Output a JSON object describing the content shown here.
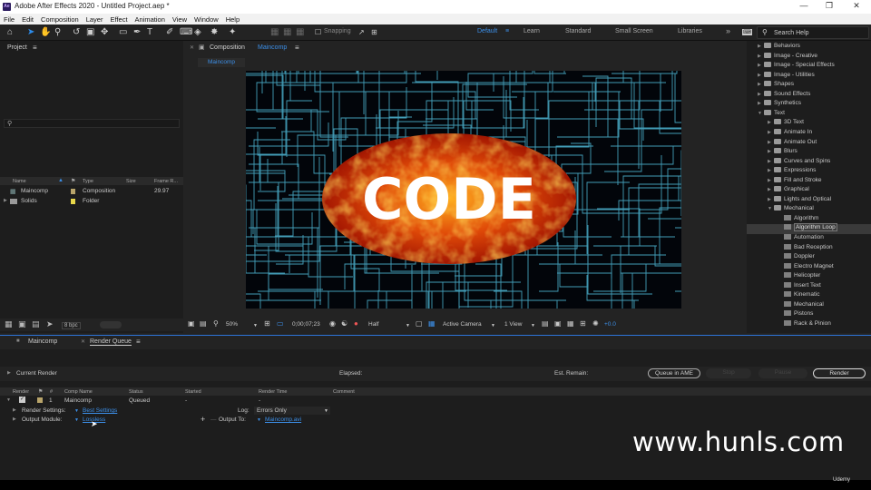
{
  "app": {
    "window_title": "Adobe After Effects 2020 - Untitled Project.aep *",
    "logo_text": "Ae"
  },
  "menu": [
    "File",
    "Edit",
    "Composition",
    "Layer",
    "Effect",
    "Animation",
    "View",
    "Window",
    "Help"
  ],
  "toolbar": {
    "snapping_label": "Snapping",
    "workspaces": [
      "Default",
      "Learn",
      "Standard",
      "Small Screen",
      "Libraries"
    ],
    "active_workspace": "Default",
    "help_placeholder": "Search Help"
  },
  "project": {
    "title": "Project",
    "columns": [
      "Name",
      "Type",
      "Size",
      "Frame R..."
    ],
    "items": [
      {
        "name": "Maincomp",
        "type": "Composition",
        "rate": "29.97",
        "color": "#b8a46a"
      },
      {
        "name": "Solids",
        "type": "Folder",
        "rate": "",
        "color": "#e8d84a"
      }
    ],
    "bpc": "8 bpc"
  },
  "composition": {
    "panel_label": "Composition",
    "comp_name": "Maincomp",
    "tab": "Maincomp",
    "viewer_text": "CODE",
    "zoom": "50%",
    "timecode": "0;00;07;23",
    "resolution": "Half",
    "camera": "Active Camera",
    "views": "1 View",
    "exposure": "+0.0"
  },
  "effects": {
    "items": [
      {
        "label": "Behaviors",
        "level": 1,
        "kind": "folder",
        "open": false
      },
      {
        "label": "Image - Creative",
        "level": 1,
        "kind": "folder",
        "open": false
      },
      {
        "label": "Image - Special Effects",
        "level": 1,
        "kind": "folder",
        "open": false
      },
      {
        "label": "Image - Utilities",
        "level": 1,
        "kind": "folder",
        "open": false
      },
      {
        "label": "Shapes",
        "level": 1,
        "kind": "folder",
        "open": false
      },
      {
        "label": "Sound Effects",
        "level": 1,
        "kind": "folder",
        "open": false
      },
      {
        "label": "Synthetics",
        "level": 1,
        "kind": "folder",
        "open": false
      },
      {
        "label": "Text",
        "level": 1,
        "kind": "folder",
        "open": true
      },
      {
        "label": "3D Text",
        "level": 2,
        "kind": "folder",
        "open": false
      },
      {
        "label": "Animate In",
        "level": 2,
        "kind": "folder",
        "open": false
      },
      {
        "label": "Animate Out",
        "level": 2,
        "kind": "folder",
        "open": false
      },
      {
        "label": "Blurs",
        "level": 2,
        "kind": "folder",
        "open": false
      },
      {
        "label": "Curves and Spins",
        "level": 2,
        "kind": "folder",
        "open": false
      },
      {
        "label": "Expressions",
        "level": 2,
        "kind": "folder",
        "open": false
      },
      {
        "label": "Fill and Stroke",
        "level": 2,
        "kind": "folder",
        "open": false
      },
      {
        "label": "Graphical",
        "level": 2,
        "kind": "folder",
        "open": false
      },
      {
        "label": "Lights and Optical",
        "level": 2,
        "kind": "folder",
        "open": false
      },
      {
        "label": "Mechanical",
        "level": 2,
        "kind": "folder",
        "open": true
      },
      {
        "label": "Algorithm",
        "level": 3,
        "kind": "preset",
        "open": false
      },
      {
        "label": "Algorithm Loop",
        "level": 3,
        "kind": "preset",
        "selected": true
      },
      {
        "label": "Automation",
        "level": 3,
        "kind": "preset"
      },
      {
        "label": "Bad Reception",
        "level": 3,
        "kind": "preset"
      },
      {
        "label": "Doppler",
        "level": 3,
        "kind": "preset"
      },
      {
        "label": "Electro Magnet",
        "level": 3,
        "kind": "preset"
      },
      {
        "label": "Helicopter",
        "level": 3,
        "kind": "preset"
      },
      {
        "label": "Insert Text",
        "level": 3,
        "kind": "preset"
      },
      {
        "label": "Kinematic",
        "level": 3,
        "kind": "preset"
      },
      {
        "label": "Mechanical",
        "level": 3,
        "kind": "preset"
      },
      {
        "label": "Pistons",
        "level": 3,
        "kind": "preset"
      },
      {
        "label": "Rack & Pinion",
        "level": 3,
        "kind": "preset"
      }
    ]
  },
  "render_queue": {
    "tabs": [
      "Maincomp",
      "Render Queue"
    ],
    "current_render": "Current Render",
    "elapsed": "Elapsed:",
    "est_remain": "Est. Remain:",
    "queue_ame": "Queue in AME",
    "stop": "Stop",
    "pause": "Pause",
    "render": "Render",
    "columns": [
      "Render",
      "#",
      "Comp Name",
      "Status",
      "Started",
      "Render Time",
      "Comment"
    ],
    "item": {
      "number": "1",
      "comp": "Maincomp",
      "status": "Queued",
      "started": "-",
      "render_time": "-"
    },
    "render_settings_label": "Render Settings:",
    "render_settings_value": "Best Settings",
    "log_label": "Log:",
    "log_value": "Errors Only",
    "output_module_label": "Output Module:",
    "output_module_value": "Lossless",
    "output_to_label": "Output To:",
    "output_to_value": "Maincomp.avi"
  },
  "overlay": {
    "watermark": "www.hunls.com",
    "udemy": "Udemy"
  }
}
